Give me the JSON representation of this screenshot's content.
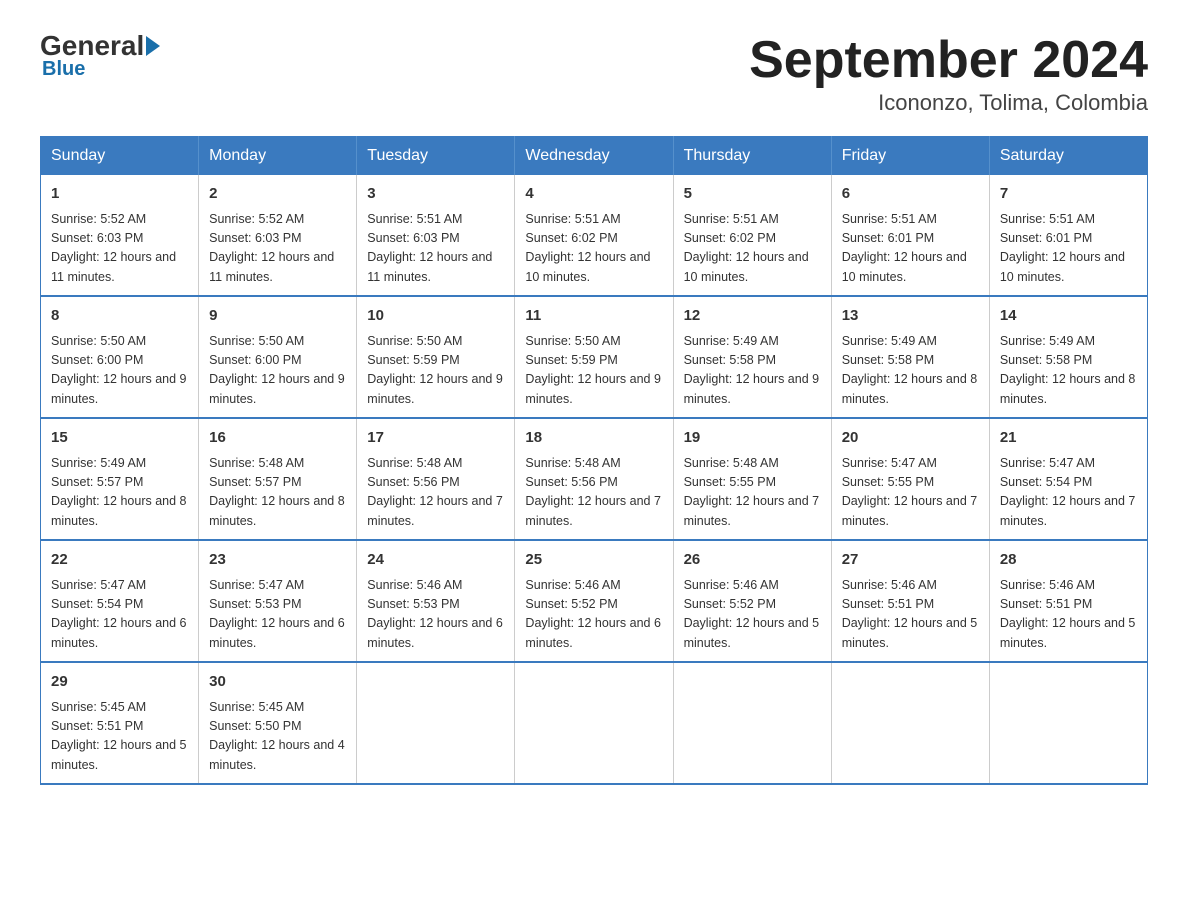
{
  "logo": {
    "general": "General",
    "blue": "Blue"
  },
  "title": "September 2024",
  "subtitle": "Icononzo, Tolima, Colombia",
  "days_of_week": [
    "Sunday",
    "Monday",
    "Tuesday",
    "Wednesday",
    "Thursday",
    "Friday",
    "Saturday"
  ],
  "weeks": [
    [
      {
        "day": "1",
        "info": "Sunrise: 5:52 AM\nSunset: 6:03 PM\nDaylight: 12 hours and 11 minutes."
      },
      {
        "day": "2",
        "info": "Sunrise: 5:52 AM\nSunset: 6:03 PM\nDaylight: 12 hours and 11 minutes."
      },
      {
        "day": "3",
        "info": "Sunrise: 5:51 AM\nSunset: 6:03 PM\nDaylight: 12 hours and 11 minutes."
      },
      {
        "day": "4",
        "info": "Sunrise: 5:51 AM\nSunset: 6:02 PM\nDaylight: 12 hours and 10 minutes."
      },
      {
        "day": "5",
        "info": "Sunrise: 5:51 AM\nSunset: 6:02 PM\nDaylight: 12 hours and 10 minutes."
      },
      {
        "day": "6",
        "info": "Sunrise: 5:51 AM\nSunset: 6:01 PM\nDaylight: 12 hours and 10 minutes."
      },
      {
        "day": "7",
        "info": "Sunrise: 5:51 AM\nSunset: 6:01 PM\nDaylight: 12 hours and 10 minutes."
      }
    ],
    [
      {
        "day": "8",
        "info": "Sunrise: 5:50 AM\nSunset: 6:00 PM\nDaylight: 12 hours and 9 minutes."
      },
      {
        "day": "9",
        "info": "Sunrise: 5:50 AM\nSunset: 6:00 PM\nDaylight: 12 hours and 9 minutes."
      },
      {
        "day": "10",
        "info": "Sunrise: 5:50 AM\nSunset: 5:59 PM\nDaylight: 12 hours and 9 minutes."
      },
      {
        "day": "11",
        "info": "Sunrise: 5:50 AM\nSunset: 5:59 PM\nDaylight: 12 hours and 9 minutes."
      },
      {
        "day": "12",
        "info": "Sunrise: 5:49 AM\nSunset: 5:58 PM\nDaylight: 12 hours and 9 minutes."
      },
      {
        "day": "13",
        "info": "Sunrise: 5:49 AM\nSunset: 5:58 PM\nDaylight: 12 hours and 8 minutes."
      },
      {
        "day": "14",
        "info": "Sunrise: 5:49 AM\nSunset: 5:58 PM\nDaylight: 12 hours and 8 minutes."
      }
    ],
    [
      {
        "day": "15",
        "info": "Sunrise: 5:49 AM\nSunset: 5:57 PM\nDaylight: 12 hours and 8 minutes."
      },
      {
        "day": "16",
        "info": "Sunrise: 5:48 AM\nSunset: 5:57 PM\nDaylight: 12 hours and 8 minutes."
      },
      {
        "day": "17",
        "info": "Sunrise: 5:48 AM\nSunset: 5:56 PM\nDaylight: 12 hours and 7 minutes."
      },
      {
        "day": "18",
        "info": "Sunrise: 5:48 AM\nSunset: 5:56 PM\nDaylight: 12 hours and 7 minutes."
      },
      {
        "day": "19",
        "info": "Sunrise: 5:48 AM\nSunset: 5:55 PM\nDaylight: 12 hours and 7 minutes."
      },
      {
        "day": "20",
        "info": "Sunrise: 5:47 AM\nSunset: 5:55 PM\nDaylight: 12 hours and 7 minutes."
      },
      {
        "day": "21",
        "info": "Sunrise: 5:47 AM\nSunset: 5:54 PM\nDaylight: 12 hours and 7 minutes."
      }
    ],
    [
      {
        "day": "22",
        "info": "Sunrise: 5:47 AM\nSunset: 5:54 PM\nDaylight: 12 hours and 6 minutes."
      },
      {
        "day": "23",
        "info": "Sunrise: 5:47 AM\nSunset: 5:53 PM\nDaylight: 12 hours and 6 minutes."
      },
      {
        "day": "24",
        "info": "Sunrise: 5:46 AM\nSunset: 5:53 PM\nDaylight: 12 hours and 6 minutes."
      },
      {
        "day": "25",
        "info": "Sunrise: 5:46 AM\nSunset: 5:52 PM\nDaylight: 12 hours and 6 minutes."
      },
      {
        "day": "26",
        "info": "Sunrise: 5:46 AM\nSunset: 5:52 PM\nDaylight: 12 hours and 5 minutes."
      },
      {
        "day": "27",
        "info": "Sunrise: 5:46 AM\nSunset: 5:51 PM\nDaylight: 12 hours and 5 minutes."
      },
      {
        "day": "28",
        "info": "Sunrise: 5:46 AM\nSunset: 5:51 PM\nDaylight: 12 hours and 5 minutes."
      }
    ],
    [
      {
        "day": "29",
        "info": "Sunrise: 5:45 AM\nSunset: 5:51 PM\nDaylight: 12 hours and 5 minutes."
      },
      {
        "day": "30",
        "info": "Sunrise: 5:45 AM\nSunset: 5:50 PM\nDaylight: 12 hours and 4 minutes."
      },
      {
        "day": "",
        "info": ""
      },
      {
        "day": "",
        "info": ""
      },
      {
        "day": "",
        "info": ""
      },
      {
        "day": "",
        "info": ""
      },
      {
        "day": "",
        "info": ""
      }
    ]
  ]
}
